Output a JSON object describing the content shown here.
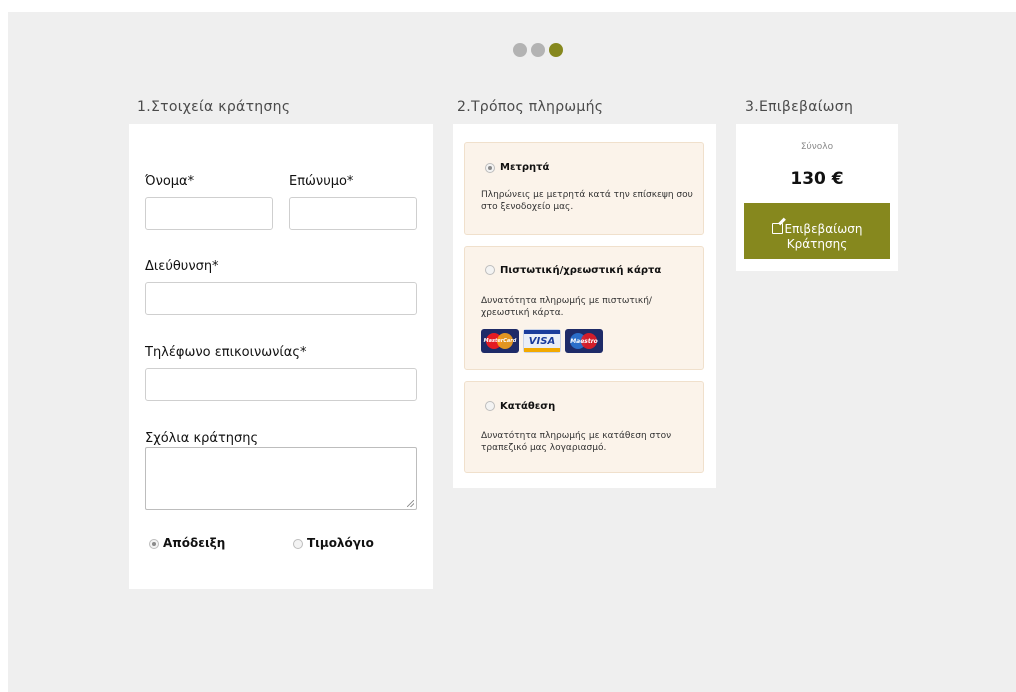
{
  "steps": {
    "count": 3,
    "active_index": 2
  },
  "columns": {
    "booking_details": {
      "title": "1.Στοιχεία κράτησης",
      "first_name_label": "Όνομα*",
      "last_name_label": "Επώνυμο*",
      "first_name_value": "",
      "last_name_value": "",
      "address_label": "Διεύθυνση*",
      "address_value": "",
      "phone_label": "Τηλέφωνο επικοινωνίας*",
      "phone_value": "",
      "comments_label": "Σχόλια κράτησης",
      "comments_value": "",
      "receipt_label": "Απόδειξη",
      "invoice_label": "Τιμολόγιο",
      "selected_document": "receipt"
    },
    "payment": {
      "title": "2.Τρόπος πληρωμής",
      "selected": "cash",
      "options": [
        {
          "id": "cash",
          "title": "Μετρητά",
          "description": "Πληρώνεις με μετρητά κατά την επίσκεψη σου στο ξενοδοχείο μας."
        },
        {
          "id": "card",
          "title": "Πιστωτική/χρεωστική κάρτα",
          "description": "Δυνατότητα πληρωμής με πιστωτική/ χρεωστική κάρτα."
        },
        {
          "id": "deposit",
          "title": "Κατάθεση",
          "description": "Δυνατότητα πληρωμής με κατάθεση στον τραπεζικό μας λογαριασμό."
        }
      ],
      "cards": [
        {
          "name": "MasterCard",
          "icon": "mastercard-icon"
        },
        {
          "name": "VISA",
          "icon": "visa-icon"
        },
        {
          "name": "Maestro",
          "icon": "maestro-icon"
        }
      ]
    },
    "confirmation": {
      "title": "3.Επιβεβαίωση",
      "total_label": "Σύνολο",
      "total_value": "130 €",
      "confirm_button_label": "Επιβεβαίωση Κράτησης",
      "confirm_icon": "edit-icon"
    }
  },
  "colors": {
    "accent": "#86881e",
    "background": "#efefef",
    "payment_box": "#fbf3ea",
    "inactive_dot": "#b3b3b3"
  }
}
